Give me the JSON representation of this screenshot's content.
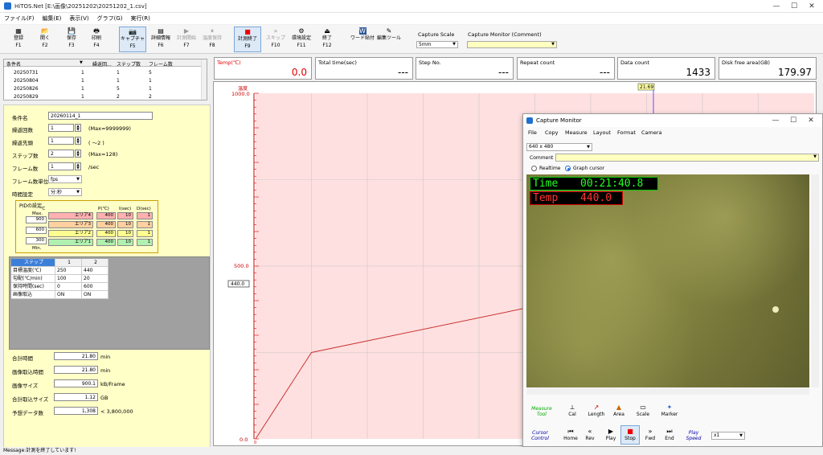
{
  "window": {
    "title": "HiTOS.Net [E:\\画像\\20251202\\20251202_1.csv]",
    "min": "—",
    "max": "☐",
    "close": "✕"
  },
  "menu": [
    "ファイル(F)",
    "編集(E)",
    "表示(V)",
    "グラフ(G)",
    "実行(R)"
  ],
  "toolbar": [
    {
      "label": "登録",
      "key": "F1",
      "icon": "▦"
    },
    {
      "label": "開く",
      "key": "F2",
      "icon": "📂"
    },
    {
      "label": "保存",
      "key": "F3",
      "icon": "💾"
    },
    {
      "label": "印刷",
      "key": "F4",
      "icon": "🖶"
    },
    {
      "label": "キャプチャ",
      "key": "F5",
      "icon": "📷"
    },
    {
      "label": "詳細情報",
      "key": "F6",
      "icon": "▤"
    },
    {
      "label": "計測開始",
      "key": "F7",
      "icon": "▶"
    },
    {
      "label": "温度保持",
      "key": "F8",
      "icon": "⏸"
    },
    {
      "label": "計測終了",
      "key": "F9",
      "icon": "■"
    },
    {
      "label": "スキップ",
      "key": "F10",
      "icon": "»"
    },
    {
      "label": "環境設定",
      "key": "F11",
      "icon": "⚙"
    },
    {
      "label": "終了",
      "key": "F12",
      "icon": "⏏"
    },
    {
      "label": "ワード貼付",
      "key": "",
      "icon": "W"
    },
    {
      "label": "編集ツール",
      "key": "",
      "icon": "✎"
    }
  ],
  "capture_scale": {
    "label": "Capture Scale",
    "value": "5mm"
  },
  "capture_monitor_comment": {
    "label": "Capture Monitor (Comment)",
    "value": ""
  },
  "stats": [
    {
      "label": "Temp(℃)",
      "value": "0.0",
      "color": "#e00000"
    },
    {
      "label": "Total time(sec)",
      "value": "---"
    },
    {
      "label": "Step No.",
      "value": "---"
    },
    {
      "label": "Repeat count",
      "value": "---"
    },
    {
      "label": "Data count",
      "value": "1433"
    },
    {
      "label": "Disk free area(GB)",
      "value": "179.97"
    }
  ],
  "condlist": {
    "headers": [
      "条件名",
      "繰返回...",
      "ステップ数",
      "フレーム数"
    ],
    "rows": [
      [
        "20250731",
        "1",
        "1",
        "5"
      ],
      [
        "20250804",
        "1",
        "1",
        "1"
      ],
      [
        "20250826",
        "1",
        "5",
        "1"
      ],
      [
        "20250829",
        "1",
        "2",
        "2"
      ]
    ]
  },
  "form": {
    "cond_name": {
      "label": "条件名",
      "value": "20260114_1"
    },
    "repeat": {
      "label": "繰返回数",
      "value": "1",
      "note": "(Max=9999999)"
    },
    "repeat_start": {
      "label": "繰返先頭",
      "value": "1",
      "note": "( ～2 )"
    },
    "steps": {
      "label": "ステップ数",
      "value": "2",
      "note": "(Max=128)"
    },
    "frames": {
      "label": "フレーム数",
      "value": "1",
      "note": "/sec"
    },
    "frame_unit": {
      "label": "フレーム数単位",
      "value": "fps"
    },
    "time_setting": {
      "label": "時間設定",
      "value": "分:秒"
    }
  },
  "pid": {
    "title": "PIDの設定",
    "unit": "℃",
    "max": "Max.",
    "min": "Min.",
    "cols": [
      "P(℃)",
      "I(sec)",
      "D(sec)"
    ],
    "rows": [
      {
        "temp": "900",
        "area": "エリア4",
        "p": "400",
        "i": "10",
        "d": "1",
        "color": "#ffb0b0"
      },
      {
        "temp": "600",
        "area": "エリア3",
        "p": "400",
        "i": "10",
        "d": "1",
        "color": "#ffd0a0"
      },
      {
        "temp": "300",
        "area": "エリア2",
        "p": "400",
        "i": "10",
        "d": "1",
        "color": "#ffff90"
      },
      {
        "temp": "",
        "area": "エリア1",
        "p": "400",
        "i": "10",
        "d": "1",
        "color": "#b0f0b0"
      }
    ]
  },
  "step_table": {
    "header": [
      "ステップ",
      "1",
      "2"
    ],
    "rows": [
      [
        "目標温度(℃)",
        "250",
        "440"
      ],
      [
        "勾配(℃/min)",
        "100",
        "20"
      ],
      [
        "保持時間(sec)",
        "0",
        "600"
      ],
      [
        "画像取込",
        "ON",
        "ON"
      ]
    ]
  },
  "summary": [
    {
      "label": "合計時間",
      "value": "21.80",
      "unit": "min"
    },
    {
      "label": "画像取込時間",
      "value": "21.80",
      "unit": "min"
    },
    {
      "label": "画像サイズ",
      "value": "900.1",
      "unit": "kB/Frame"
    },
    {
      "label": "合計取込サイズ",
      "value": "1.12",
      "unit": "GB"
    },
    {
      "label": "予想データ数",
      "value": "1,308",
      "unit": "< 3,800,000"
    }
  ],
  "graph": {
    "ylabel": "温度",
    "yticks": [
      "1000.0",
      "500.0",
      "0.0"
    ],
    "marker_value": "440.0",
    "cursor_value": "21.69",
    "x_zero": "0",
    "chart_data": {
      "type": "line",
      "ylim": [
        0,
        1000
      ],
      "xlim": [
        0,
        30
      ],
      "x": [
        0,
        3,
        20,
        21.69
      ],
      "y": [
        0,
        250,
        440,
        440
      ]
    }
  },
  "monitor": {
    "title": "Capture Monitor",
    "menu": [
      "File",
      "Copy",
      "Measure",
      "Layout",
      "Format",
      "Camera"
    ],
    "resolution": "640 x 480",
    "comment_label": "Comment",
    "radio_realtime": "Realtime",
    "radio_graph": "Graph cursor",
    "overlay_time_label": "Time",
    "overlay_time_value": "00:21:40.8",
    "overlay_temp_label": "Temp",
    "overlay_temp_value": "440.0",
    "measure_tool": "Measure Tool",
    "tools": [
      {
        "label": "Cal",
        "icon": "⟂"
      },
      {
        "label": "Length",
        "icon": "↗"
      },
      {
        "label": "Area",
        "icon": "▲"
      },
      {
        "label": "Scale",
        "icon": "▭"
      },
      {
        "label": "Marker",
        "icon": "✦"
      }
    ],
    "cursor_control": "Cursor Control",
    "cursor_buttons": [
      {
        "label": "Home",
        "icon": "⏮"
      },
      {
        "label": "Rev",
        "icon": "«"
      },
      {
        "label": "Play",
        "icon": "▶"
      },
      {
        "label": "Stop",
        "icon": "■"
      },
      {
        "label": "Fwd",
        "icon": "»"
      },
      {
        "label": "End",
        "icon": "⏭"
      }
    ],
    "play_speed": "Play Speed",
    "speed_value": "x1"
  },
  "status": "Message:計測を終了しています!"
}
